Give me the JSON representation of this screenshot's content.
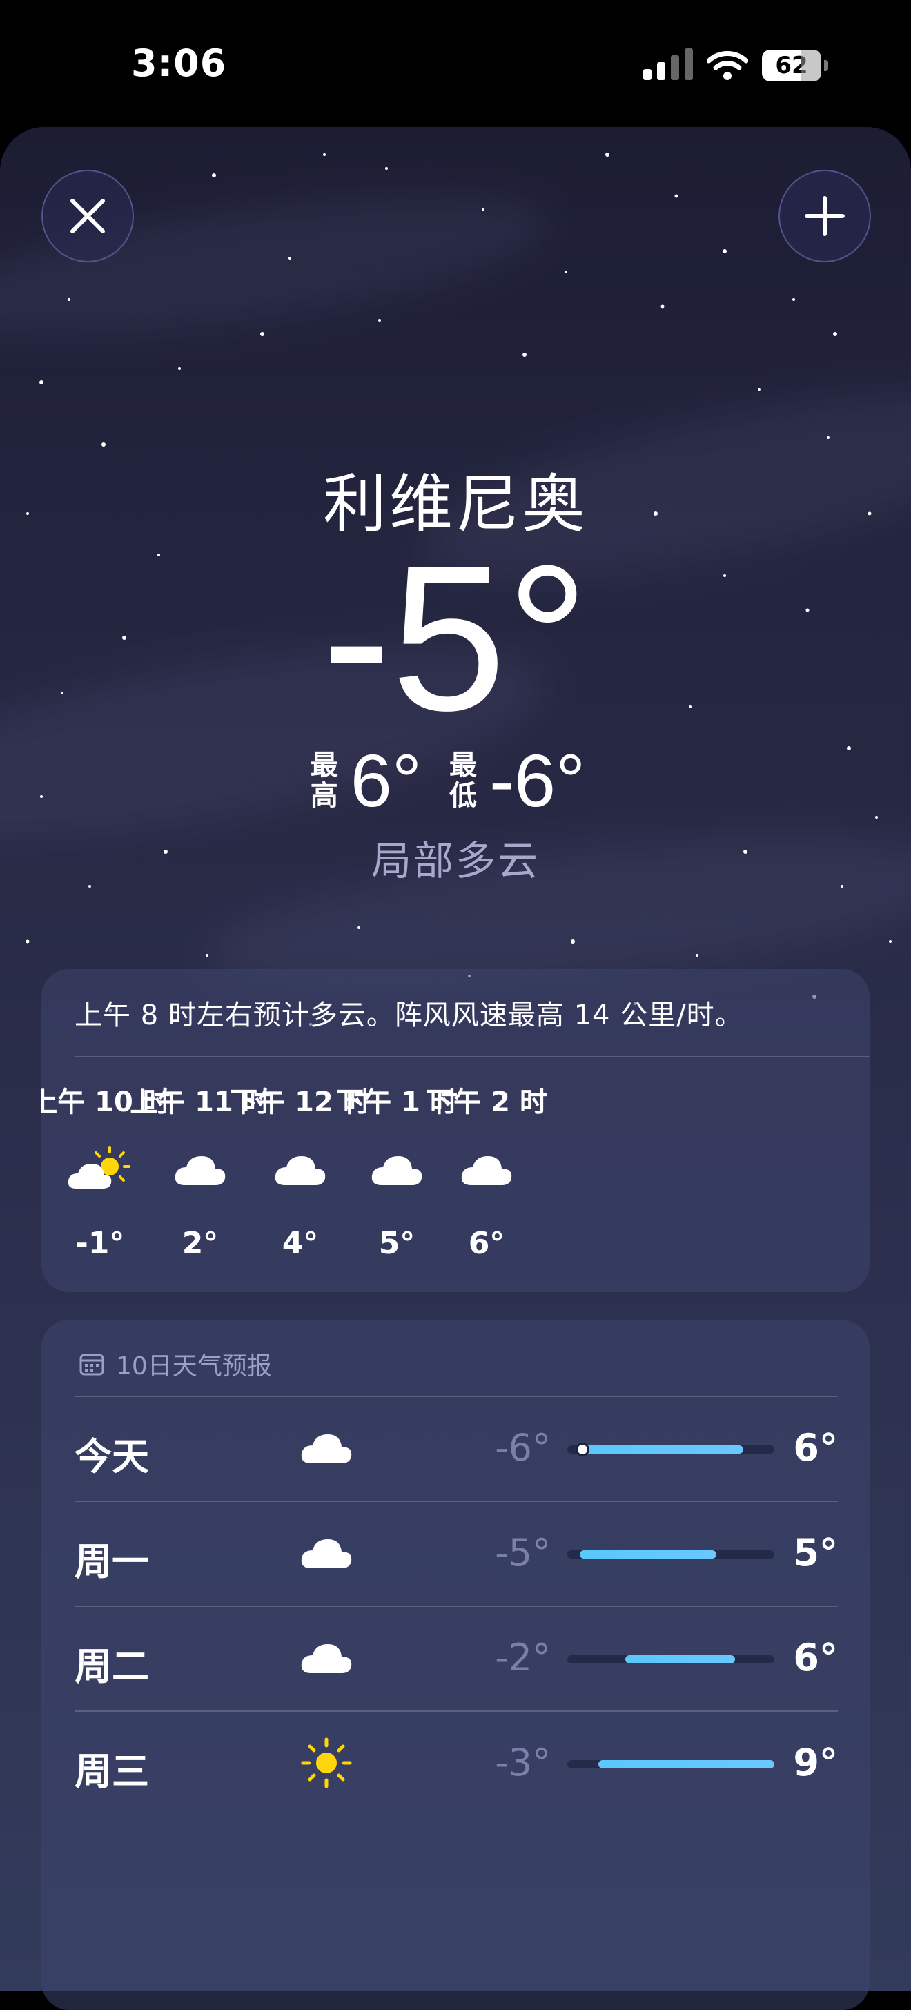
{
  "status_bar": {
    "time": "3:06",
    "battery": "62"
  },
  "location": {
    "city": "利维尼奥",
    "current_temp": "-5°",
    "high_label": [
      "最",
      "高"
    ],
    "high": "6°",
    "low_label": [
      "最",
      "低"
    ],
    "low": "-6°",
    "condition": "局部多云"
  },
  "hourly": {
    "summary": "上午 8 时左右预计多云。阵风风速最高 14 公里/时。",
    "hours": [
      {
        "label": "上午 10 时",
        "icon": "partly-sunny-icon",
        "temp": "-1°"
      },
      {
        "label": "上午 11 时",
        "icon": "cloud-icon",
        "temp": "2°"
      },
      {
        "label": "下午 12 时",
        "icon": "cloud-icon",
        "temp": "4°"
      },
      {
        "label": "下午 1 时",
        "icon": "cloud-icon",
        "temp": "5°"
      },
      {
        "label": "下午 2 时",
        "icon": "cloud-icon",
        "temp": "6°"
      }
    ]
  },
  "daily": {
    "title": "10日天气预报",
    "range_colors": {
      "bar": "#5ac8fa",
      "current_dot": "#ffffff"
    },
    "days": [
      {
        "name": "今天",
        "icon": "cloud-icon",
        "low": "-6°",
        "high": "6°",
        "bar_start": 0.06,
        "bar_end": 0.85,
        "current": 0.06
      },
      {
        "name": "周一",
        "icon": "cloud-icon",
        "low": "-5°",
        "high": "5°",
        "bar_start": 0.06,
        "bar_end": 0.72
      },
      {
        "name": "周二",
        "icon": "cloud-icon",
        "low": "-2°",
        "high": "6°",
        "bar_start": 0.28,
        "bar_end": 0.81
      },
      {
        "name": "周三",
        "icon": "sun-icon",
        "low": "-3°",
        "high": "9°",
        "bar_start": 0.15,
        "bar_end": 1.0
      }
    ]
  }
}
